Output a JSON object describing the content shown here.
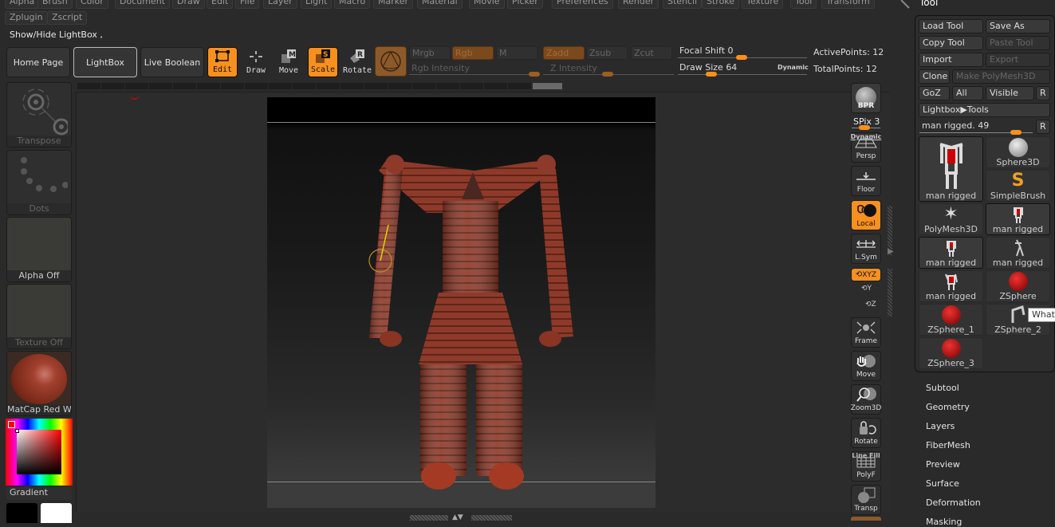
{
  "menu": {
    "row1": [
      "Alpha",
      "Brush",
      "Color",
      "Document",
      "Draw",
      "Edit",
      "File",
      "Layer",
      "Light",
      "Macro",
      "Marker",
      "Material",
      "Movie",
      "Picker",
      "Preferences",
      "Render",
      "Stencil",
      "Stroke",
      "Texture",
      "Tool",
      "Transform"
    ],
    "row2": [
      "Zplugin",
      "Zscript"
    ]
  },
  "status_text": "Show/Hide LightBox ,",
  "palette_title": "Tool",
  "toolbar": {
    "home_page": "Home Page",
    "lightbox": "LightBox",
    "live_boolean": "Live Boolean",
    "modes": [
      {
        "label": "Edit",
        "active": true
      },
      {
        "label": "Draw",
        "active": false
      },
      {
        "label": "Move",
        "active": false,
        "key": "M"
      },
      {
        "label": "Scale",
        "active": true,
        "key": "S"
      },
      {
        "label": "Rotate",
        "active": false,
        "key": "R"
      }
    ],
    "color_modes": {
      "mrgb": "Mrgb",
      "rgb": "Rgb",
      "m": "M"
    },
    "z_modes": {
      "zadd": "Zadd",
      "zsub": "Zsub",
      "zcut": "Zcut"
    },
    "rgb_intensity": {
      "label": "Rgb Intensity"
    },
    "z_intensity": {
      "label": "Z Intensity"
    },
    "focal_shift": {
      "label": "Focal Shift",
      "value": "0"
    },
    "draw_size": {
      "label": "Draw Size",
      "value": "64"
    },
    "dynamic": "Dynamic",
    "active_points": "ActivePoints: 12",
    "total_points": "TotalPoints: 12"
  },
  "left_shelf": {
    "transpose": "Transpose",
    "dots": "Dots",
    "alpha": "Alpha Off",
    "texture": "Texture Off",
    "material": "MatCap Red Wa",
    "gradient": "Gradient",
    "main_color": "#000000",
    "secondary_color": "#ffffff",
    "picker_color": "#ff0000"
  },
  "right_shelf": {
    "bpr": "BPR",
    "spix": "SPix 3",
    "persp": "Persp",
    "persp_dynamic": "Dynamic",
    "floor": "Floor",
    "local": "Local",
    "lsym": "L.Sym",
    "xyz": "XYZ",
    "y": "Y",
    "z": "Z",
    "frame": "Frame",
    "move": "Move",
    "zoom3d": "Zoom3D",
    "rotate": "Rotate",
    "polyf": "PolyF",
    "polyf_top": "Line Fill",
    "transp": "Transp"
  },
  "tool_palette": {
    "load_tool": "Load Tool",
    "save_as": "Save As",
    "copy_tool": "Copy Tool",
    "paste_tool": "Paste Tool",
    "import": "Import",
    "export": "Export",
    "clone": "Clone",
    "make_polymesh": "Make PolyMesh3D",
    "goz": "GoZ",
    "all": "All",
    "visible": "Visible",
    "r": "R",
    "lightbox_tools": "Lightbox▶Tools",
    "current_tool": "man rigged. 49",
    "thumbs": [
      "man rigged",
      "Sphere3D",
      "SimpleBrush",
      "PolyMesh3D",
      "man rigged",
      "man rigged",
      "man rigged",
      "man rigged",
      "ZSphere",
      "ZSphere_1",
      "ZSphere_2",
      "ZSphere_3"
    ],
    "tooltip": "Whats"
  },
  "sections": [
    "Subtool",
    "Geometry",
    "Layers",
    "FiberMesh",
    "Preview",
    "Surface",
    "Deformation",
    "Masking"
  ]
}
